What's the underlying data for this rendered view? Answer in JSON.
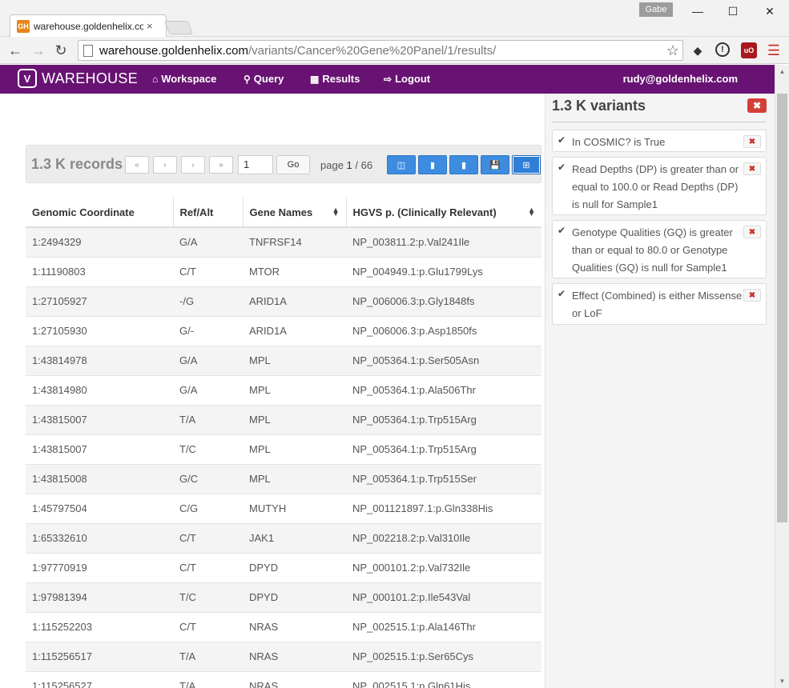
{
  "browser": {
    "tab_title": "warehouse.goldenhelix.co",
    "tab_close": "×",
    "profile_name": "Gabe",
    "url_domain": "warehouse.goldenhelix.com",
    "url_path": "/variants/Cancer%20Gene%20Panel/1/results/",
    "favicon_text": "GH"
  },
  "app": {
    "brand": "WAREHOUSE",
    "nav": [
      {
        "label": "Workspace",
        "icon": "home-icon"
      },
      {
        "label": "Query",
        "icon": "search-icon"
      },
      {
        "label": "Results",
        "icon": "table-icon"
      },
      {
        "label": "Logout",
        "icon": "logout-icon"
      }
    ],
    "user_email": "rudy@goldenhelix.com"
  },
  "results": {
    "records_label": "1.3 K records",
    "page_input_value": "1",
    "go_label": "Go",
    "page_prefix": "page",
    "page_current": "1",
    "page_sep": "/",
    "page_total": "66",
    "pager": [
      "«",
      "‹",
      "›",
      "»"
    ],
    "columns": [
      "Genomic Coordinate",
      "Ref/Alt",
      "Gene Names",
      "HGVS p. (Clinically Relevant)"
    ],
    "rows": [
      [
        "1:2494329",
        "G/A",
        "TNFRSF14",
        "NP_003811.2:p.Val241Ile"
      ],
      [
        "1:11190803",
        "C/T",
        "MTOR",
        "NP_004949.1:p.Glu1799Lys"
      ],
      [
        "1:27105927",
        "-/G",
        "ARID1A",
        "NP_006006.3:p.Gly1848fs"
      ],
      [
        "1:27105930",
        "G/-",
        "ARID1A",
        "NP_006006.3:p.Asp1850fs"
      ],
      [
        "1:43814978",
        "G/A",
        "MPL",
        "NP_005364.1:p.Ser505Asn"
      ],
      [
        "1:43814980",
        "G/A",
        "MPL",
        "NP_005364.1:p.Ala506Thr"
      ],
      [
        "1:43815007",
        "T/A",
        "MPL",
        "NP_005364.1:p.Trp515Arg"
      ],
      [
        "1:43815007",
        "T/C",
        "MPL",
        "NP_005364.1:p.Trp515Arg"
      ],
      [
        "1:43815008",
        "G/C",
        "MPL",
        "NP_005364.1:p.Trp515Ser"
      ],
      [
        "1:45797504",
        "C/G",
        "MUTYH",
        "NP_001121897.1:p.Gln338His"
      ],
      [
        "1:65332610",
        "C/T",
        "JAK1",
        "NP_002218.2:p.Val310Ile"
      ],
      [
        "1:97770919",
        "C/T",
        "DPYD",
        "NP_000101.2:p.Val732Ile"
      ],
      [
        "1:97981394",
        "T/C",
        "DPYD",
        "NP_000101.2:p.Ile543Val"
      ],
      [
        "1:115252203",
        "C/T",
        "NRAS",
        "NP_002515.1:p.Ala146Thr"
      ],
      [
        "1:115256517",
        "T/A",
        "NRAS",
        "NP_002515.1:p.Ser65Cys"
      ],
      [
        "1:115256527",
        "T/A",
        "NRAS",
        "NP_002515.1:p.Gln61His"
      ]
    ]
  },
  "filters": {
    "title": "1.3 K variants",
    "items": [
      {
        "text": "In COSMIC? is True"
      },
      {
        "text": "Read Depths (DP) is greater than or equal to 100.0 or Read Depths (DP) is null for Sample1"
      },
      {
        "text": "Genotype Qualities (GQ) is greater than or equal to 80.0 or Genotype Qualities (GQ) is null for Sample1"
      },
      {
        "text": "Effect (Combined) is either Missense or LoF"
      }
    ]
  },
  "colors": {
    "navbar": "#681373",
    "primary_button": "#3e8ce0",
    "danger": "#d43f3a"
  }
}
